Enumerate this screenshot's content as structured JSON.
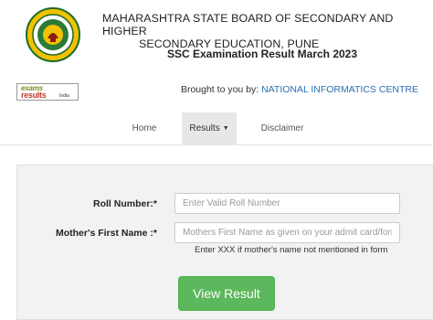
{
  "header": {
    "board_line1": "MAHARASHTRA STATE BOARD OF SECONDARY AND HIGHER",
    "board_line2": "SECONDARY EDUCATION, PUNE",
    "exam_title": "SSC Examination Result March 2023"
  },
  "branding": {
    "logo_top": "exams",
    "logo_bottom": "results",
    "logo_india": "India",
    "brought_prefix": "Brought to you by: ",
    "brought_link": "NATIONAL INFORMATICS CENTRE"
  },
  "nav": {
    "home": "Home",
    "results": "Results",
    "disclaimer": "Disclaimer"
  },
  "form": {
    "roll_label": "Roll Number:*",
    "roll_placeholder": "Enter Valid Roll Number",
    "mother_label": "Mother's First Name :*",
    "mother_placeholder": "Mothers First Name as given on your admit card/form",
    "mother_hint": "Enter XXX if mother's name not mentioned in form",
    "submit_label": "View Result"
  },
  "colors": {
    "submit_green": "#5cb85c",
    "link_blue": "#2a6fb5",
    "panel_bg": "#f2f2f2"
  }
}
